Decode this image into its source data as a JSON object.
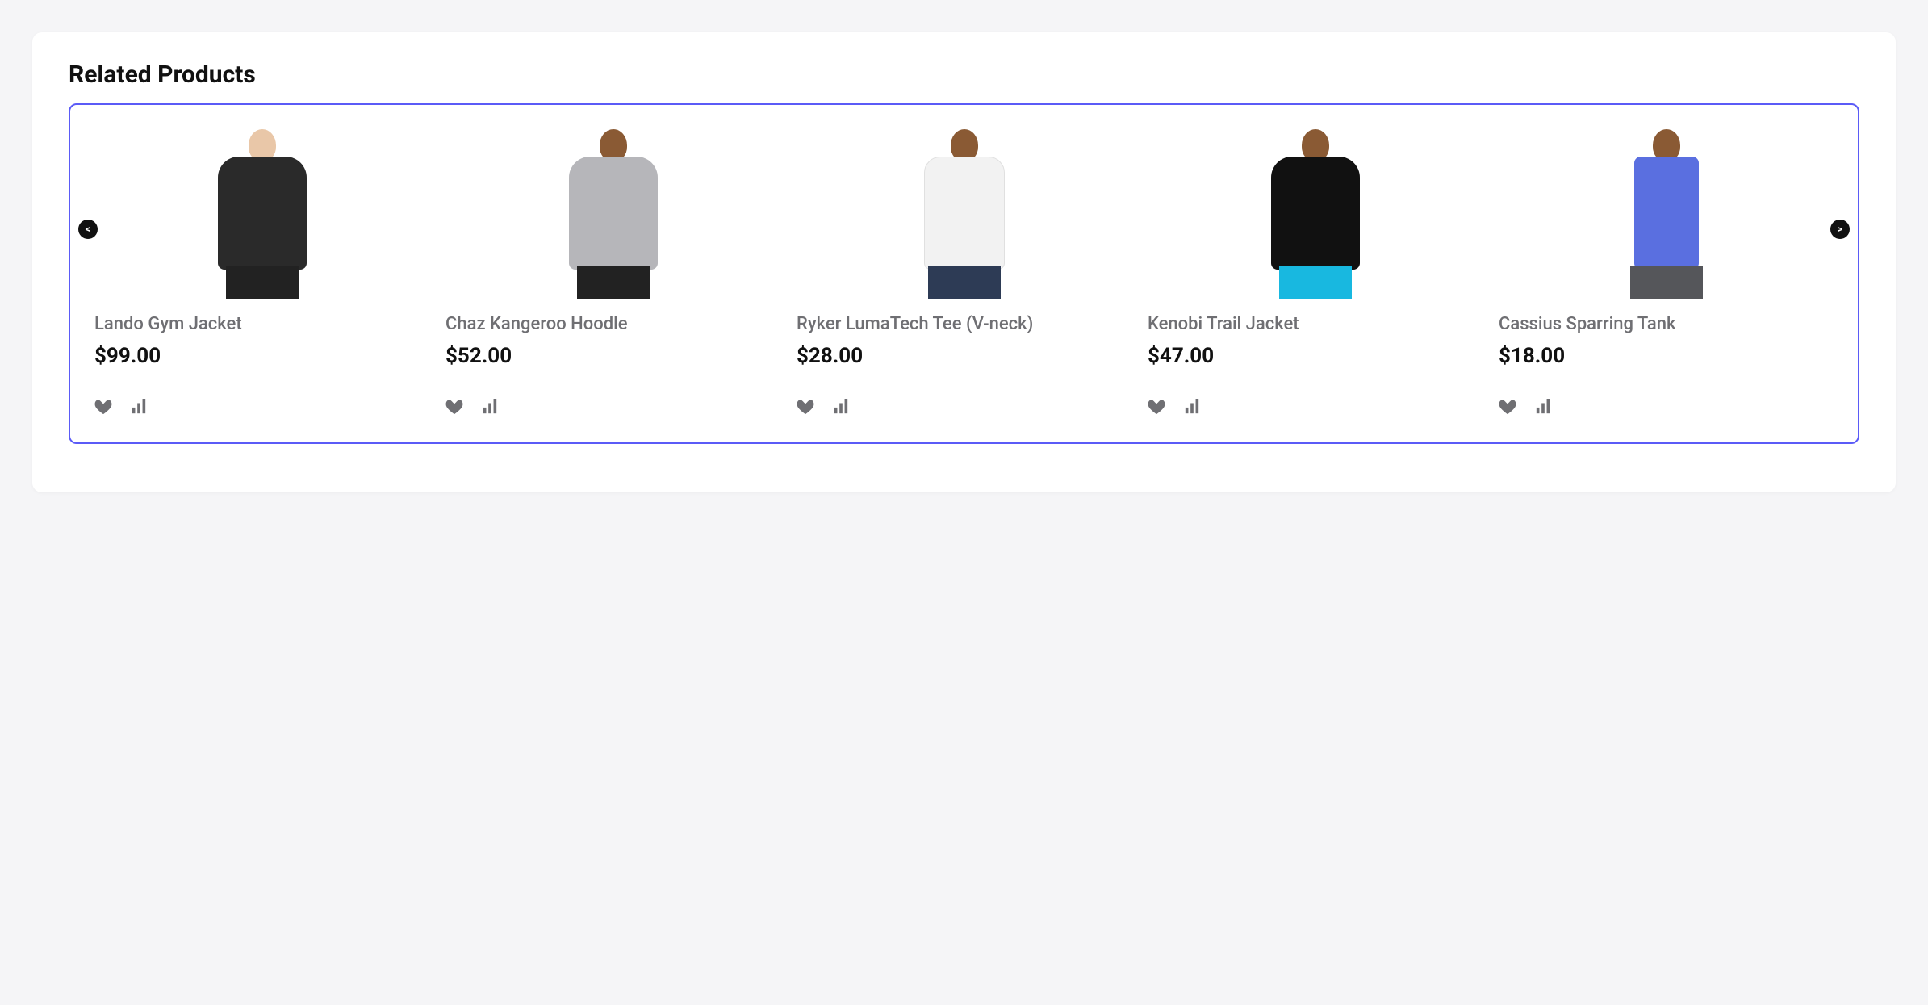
{
  "section_title": "Related Products",
  "nav": {
    "prev": "<",
    "next": ">"
  },
  "products": [
    {
      "name": "Lando Gym Jacket",
      "price": "$99.00"
    },
    {
      "name": "Chaz Kangeroo Hoodle",
      "price": "$52.00"
    },
    {
      "name": "Ryker LumaTech Tee (V-neck)",
      "price": "$28.00"
    },
    {
      "name": "Kenobi Trail Jacket",
      "price": "$47.00"
    },
    {
      "name": "Cassius Sparring Tank",
      "price": "$18.00"
    }
  ]
}
